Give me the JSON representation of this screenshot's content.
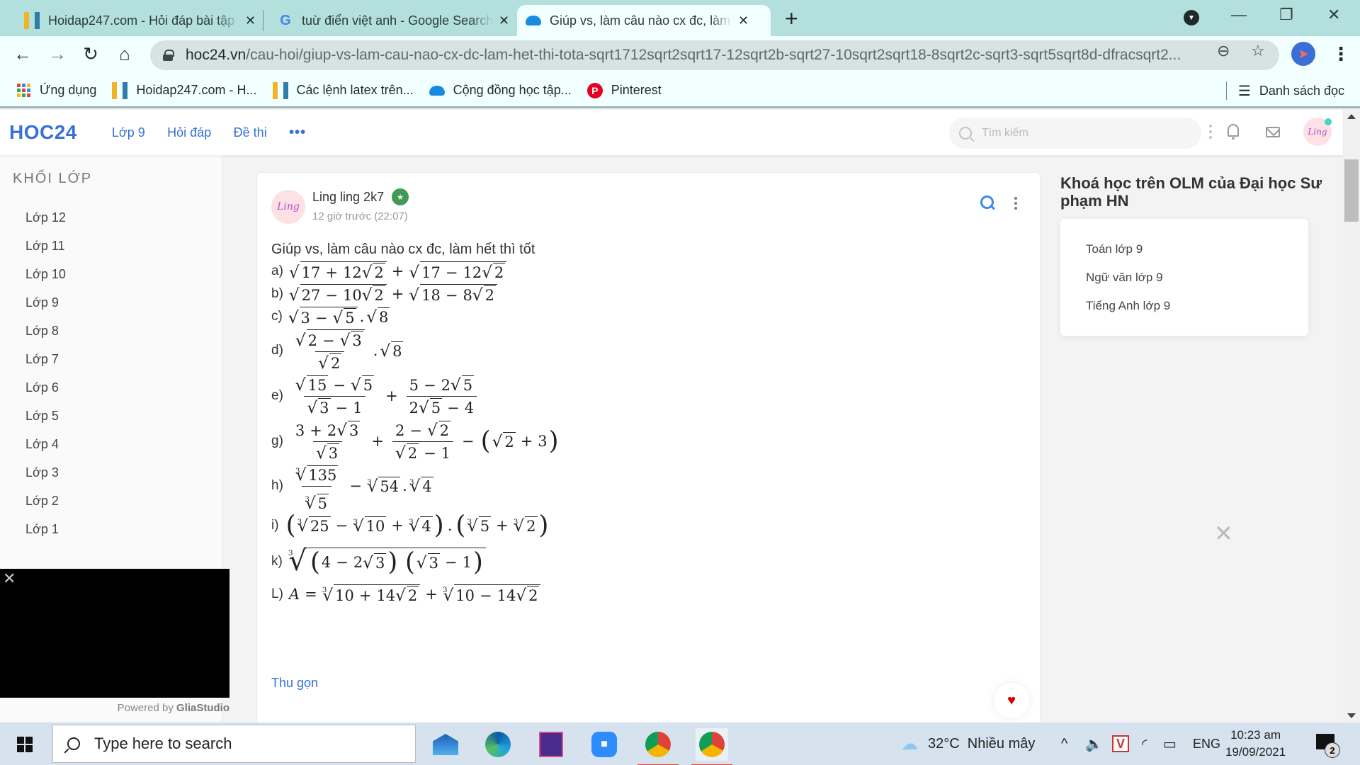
{
  "browser": {
    "tabs": [
      {
        "title": "Hoidap247.com - Hỏi đáp bài tập",
        "icon": "hoidap247-icon",
        "active": false
      },
      {
        "title": "tuừ điển việt anh - Google Search",
        "icon": "google-icon",
        "active": false
      },
      {
        "title": "Giúp vs, làm câu nào cx đc, làm hết thì tốt",
        "icon": "olm-cloud-icon",
        "active": true
      }
    ],
    "new_tab_label": "+",
    "url_host": "hoc24.vn",
    "url_path": "/cau-hoi/giup-vs-lam-cau-nao-cx-dc-lam-het-thi-tota-sqrt1712sqrt2sqrt17-12sqrt2b-sqrt27-10sqrt2sqrt18-8sqrt2c-sqrt3-sqrt5sqrt8d-dfracsqrt2...",
    "bookmarks": [
      {
        "label": "Ứng dụng",
        "icon": "apps-grid-icon"
      },
      {
        "label": "Hoidap247.com - H...",
        "icon": "hoidap247-icon"
      },
      {
        "label": "Các lệnh latex trên...",
        "icon": "hoidap247-icon"
      },
      {
        "label": "Cộng đồng học tập...",
        "icon": "olm-cloud-icon"
      },
      {
        "label": "Pinterest",
        "icon": "pinterest-icon"
      }
    ],
    "reading_list_label": "Danh sách đọc"
  },
  "site": {
    "logo": "HOC24",
    "nav": [
      "Lớp 9",
      "Hỏi đáp",
      "Đề thi"
    ],
    "more_label": "•••",
    "search_placeholder": "Tìm kiếm",
    "user_avatar_text": "Ling"
  },
  "left_sidebar": {
    "heading": "KHỐI LỚP",
    "items": [
      "Lớp 12",
      "Lớp 11",
      "Lớp 10",
      "Lớp 9",
      "Lớp 8",
      "Lớp 7",
      "Lớp 6",
      "Lớp 5",
      "Lớp 4",
      "Lớp 3",
      "Lớp 2",
      "Lớp 1"
    ]
  },
  "video_ad": {
    "close_label": "✕",
    "powered_prefix": "Powered by ",
    "powered_brand": "GliaStudio"
  },
  "question": {
    "author": "Ling ling 2k7",
    "avatar_text": "Ling",
    "time": "12 giờ trước (22:07)",
    "intro": "Giúp vs, làm câu nào cx đc, làm hết thì tốt",
    "labels": {
      "a": "a)",
      "b": "b)",
      "c": "c)",
      "d": "d)",
      "e": "e)",
      "g": "g)",
      "h": "h)",
      "i": "i)",
      "k": "k)",
      "L": "L)"
    },
    "tokens": {
      "n17": "17",
      "n12": "12",
      "n2": "2",
      "n27": "27",
      "n10": "10",
      "n18": "18",
      "n8": "8",
      "n3": "3",
      "n5": "5",
      "n15": "15",
      "n1": "1",
      "n4": "4",
      "n135": "135",
      "n54": "54",
      "n25": "25",
      "n14": "14",
      "plus": "+",
      "minus": "−",
      "eq": "=",
      "dot": ".",
      "A": "A",
      "lp": "(",
      "rp": ")",
      "cube": "3"
    },
    "collapse_label": "Thu gọn"
  },
  "right_sidebar": {
    "title": "Khoá học trên OLM của Đại học Sư phạm HN",
    "courses": [
      "Toán lớp 9",
      "Ngữ văn lớp 9",
      "Tiếng Anh lớp 9"
    ],
    "ad_close_label": "✕"
  },
  "taskbar": {
    "search_placeholder": "Type here to search",
    "apps": [
      "mail-icon",
      "edge-icon",
      "word-game-icon",
      "zoom-icon",
      "chrome-icon",
      "chrome-profile-icon"
    ],
    "weather": "32°C  Nhiều mây",
    "language": "ENG",
    "time": "10:23 am",
    "date": "19/09/2021",
    "notification_count": "2"
  }
}
